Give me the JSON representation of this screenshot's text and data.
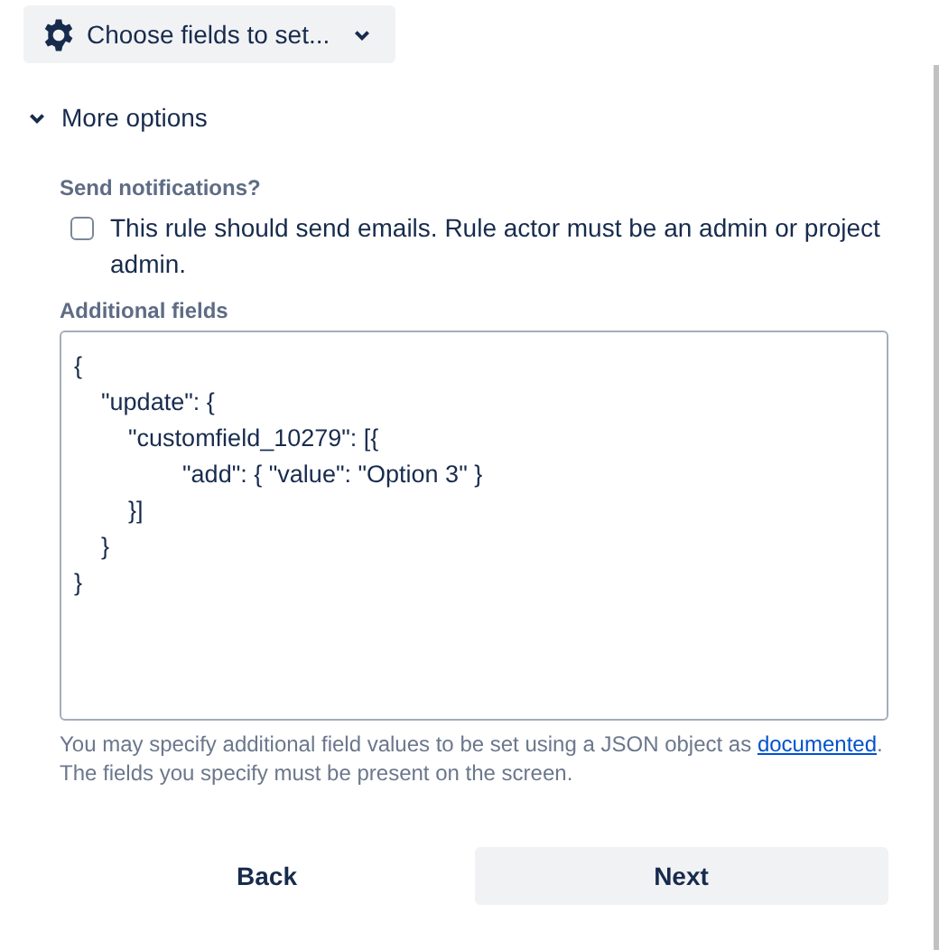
{
  "fields_dropdown": {
    "label": "Choose fields to set..."
  },
  "more_options": {
    "label": "More options",
    "expanded": true
  },
  "notifications": {
    "label": "Send notifications?",
    "checkbox_label": "This rule should send emails. Rule actor must be an admin or project admin.",
    "checked": false
  },
  "additional_fields": {
    "label": "Additional fields",
    "value": "{\n    \"update\": {\n        \"customfield_10279\": [{\n                \"add\": { \"value\": \"Option 3\" }\n        }]\n    }\n}"
  },
  "help": {
    "before": "You may specify additional field values to be set using a JSON object as ",
    "link": "documented",
    "after": ". The fields you specify must be present on the screen."
  },
  "buttons": [
    {
      "label": "Back",
      "kind": "subtle"
    },
    {
      "label": "Next",
      "kind": "default"
    }
  ]
}
